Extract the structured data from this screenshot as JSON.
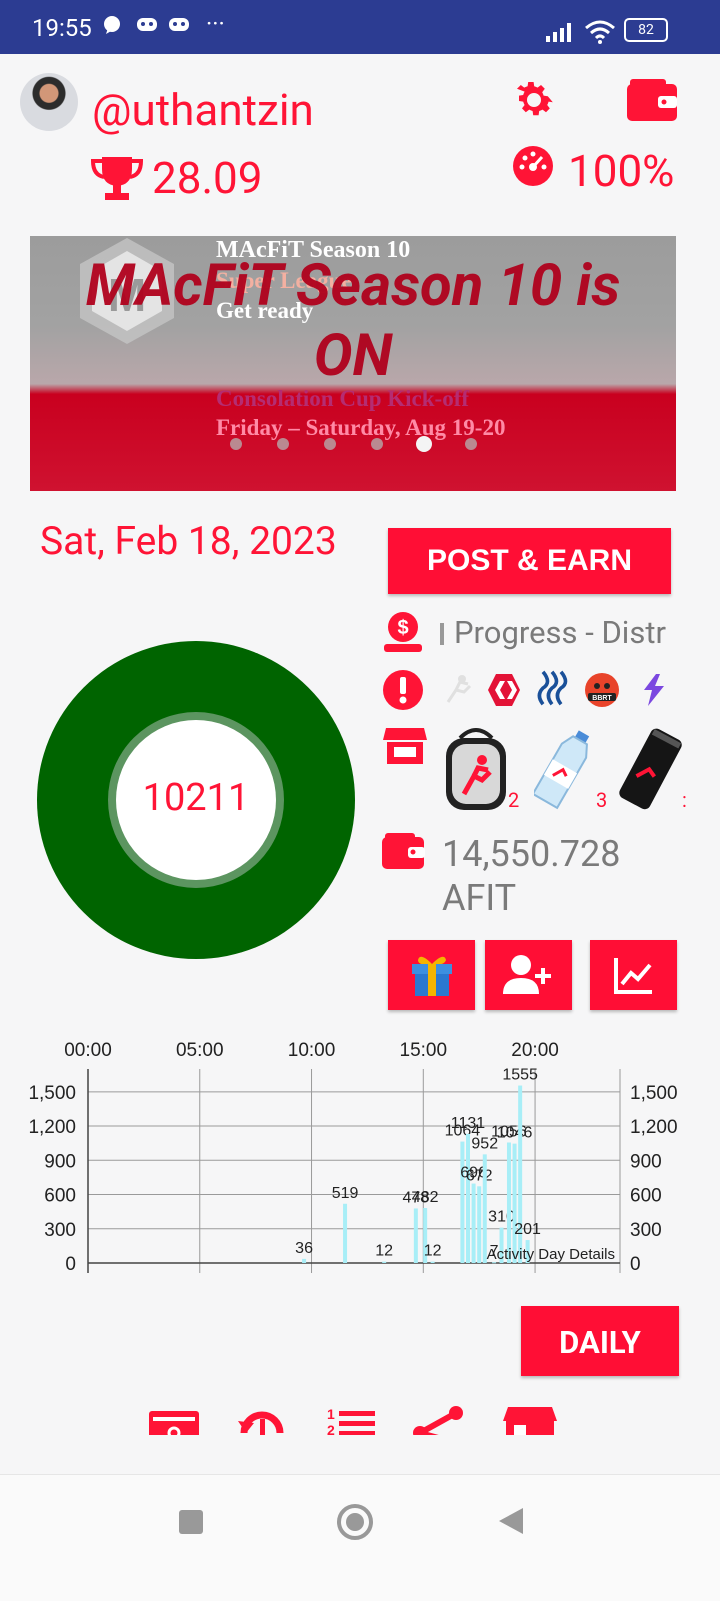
{
  "status_bar": {
    "time": "19:55",
    "battery": "82",
    "more": "···"
  },
  "profile": {
    "username": "@uthantzin",
    "trophy_value": "28.09",
    "energy_percent": "100%"
  },
  "banner": {
    "lines": [
      "MAcFiT Season 10",
      "Super League",
      "Get ready",
      "Consolation Cup Kick-off",
      "Friday – Saturday, Aug 19-20"
    ],
    "headline_1": "MAcFiT Season 10 is",
    "headline_2": "ON",
    "carousel_active_index": 4,
    "carousel_count": 6
  },
  "main": {
    "date": "Sat, Feb 18, 2023",
    "post_button": "POST & EARN",
    "steps": "10211",
    "progress_text": "Progress - Distr",
    "product_counts": [
      "2",
      "3"
    ],
    "balance": "14,550.728",
    "balance_unit": "AFIT",
    "daily_button": "DAILY"
  },
  "colors": {
    "accent": "#ff0e35",
    "status_bar": "#2c3c92",
    "ring": "#006400",
    "ring_inner": "#5c9560",
    "bar": "#a8eef7"
  },
  "icons": [
    "trophy-icon",
    "settings-icon",
    "wallet-icon",
    "gauge-icon",
    "dollar-bag-icon",
    "alert-icon",
    "shop-icon",
    "gift-icon",
    "add-user-icon",
    "trend-icon"
  ],
  "chart_data": {
    "type": "bar",
    "title": "",
    "annotation": "Activity Day Details",
    "x_ticks": [
      "00:00",
      "05:00",
      "10:00",
      "15:00",
      "20:00"
    ],
    "y_ticks": [
      "0",
      "300",
      "600",
      "900",
      "1,200",
      "1,500"
    ],
    "ylim": [
      0,
      1700
    ],
    "grid": true,
    "series": [
      {
        "values": [
          {
            "x": "9:40",
            "y": 36,
            "label": "36"
          },
          {
            "x": "11:30",
            "y": 519,
            "label": "519"
          },
          {
            "x": "13:15",
            "y": 12,
            "label": "12"
          },
          {
            "x": "14:40",
            "y": 478,
            "label": "478"
          },
          {
            "x": "15:05",
            "y": 482,
            "label": "482"
          },
          {
            "x": "15:25",
            "y": 12,
            "label": "12"
          },
          {
            "x": "16:45",
            "y": 1064,
            "label": "1064"
          },
          {
            "x": "17:00",
            "y": 1131,
            "label": "1131"
          },
          {
            "x": "17:15",
            "y": 696,
            "label": "696"
          },
          {
            "x": "17:30",
            "y": 672,
            "label": "672"
          },
          {
            "x": "17:45",
            "y": 952,
            "label": "952"
          },
          {
            "x": "18:10",
            "y": 7,
            "label": "7"
          },
          {
            "x": "18:30",
            "y": 310,
            "label": "310"
          },
          {
            "x": "18:50",
            "y": 1056,
            "label": "1056"
          },
          {
            "x": "19:05",
            "y": 1046,
            "label": "1046"
          },
          {
            "x": "19:20",
            "y": 1555,
            "label": "1555"
          },
          {
            "x": "19:40",
            "y": 201,
            "label": "201"
          }
        ]
      }
    ]
  }
}
